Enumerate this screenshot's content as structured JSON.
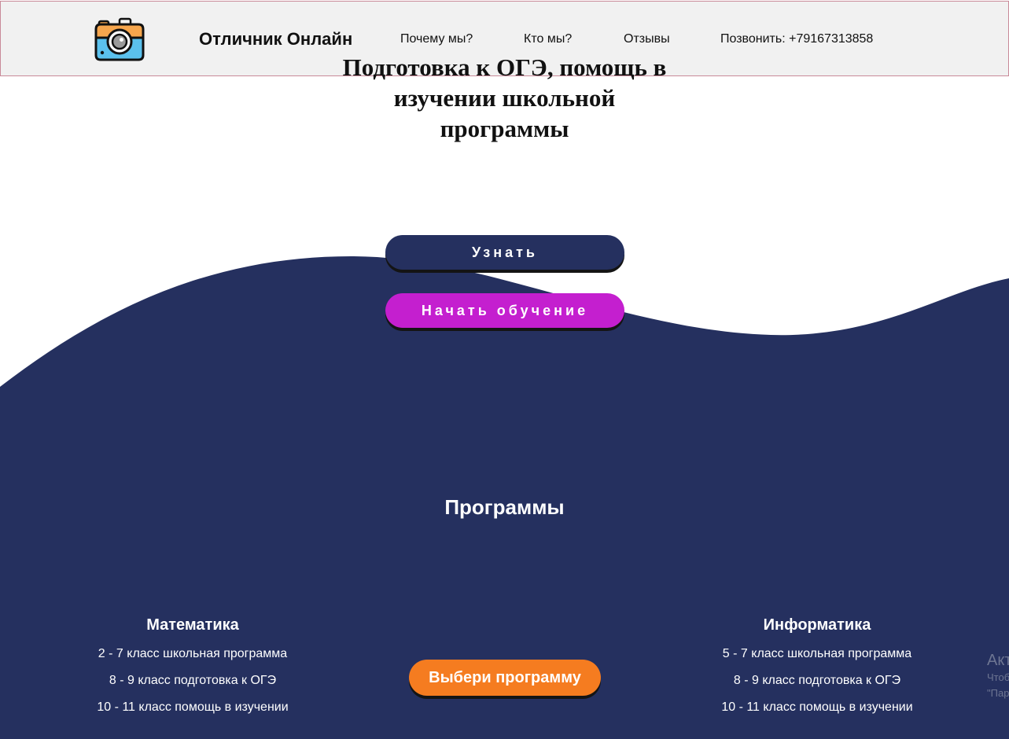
{
  "header": {
    "brand": "Отличник Онлайн",
    "nav": [
      {
        "label": "Почему мы?"
      },
      {
        "label": "Кто мы?"
      },
      {
        "label": "Отзывы"
      },
      {
        "label": "Позвонить: +79167313858"
      }
    ]
  },
  "hero": {
    "title": "Подготовка к ОГЭ, помощь в изучении школьной программы",
    "learn_button": "Узнать",
    "start_button": "Начать обучение"
  },
  "programs": {
    "title": "Программы",
    "choose_button": "Выбери программу",
    "items": [
      {
        "title": "Математика",
        "lines": [
          "2 - 7 класс школьная программа",
          "8 - 9 класс подготовка к ОГЭ",
          "10 - 11 класс помощь в изучении"
        ]
      },
      {
        "title": "Информатика",
        "lines": [
          "5 - 7 класс школьная программа",
          "8 - 9 класс подготовка к ОГЭ",
          "10 - 11 класс помощь в изучении"
        ]
      }
    ]
  },
  "watermark": {
    "title": "Акт",
    "line1": "Чтоб",
    "line2": "\"Пар"
  },
  "colors": {
    "navy": "#25305f",
    "magenta": "#c41fcf",
    "orange": "#f57c20",
    "header_bg": "#f1f1f1",
    "header_border": "#c98a99"
  },
  "icons": {
    "logo": "camera-icon"
  }
}
